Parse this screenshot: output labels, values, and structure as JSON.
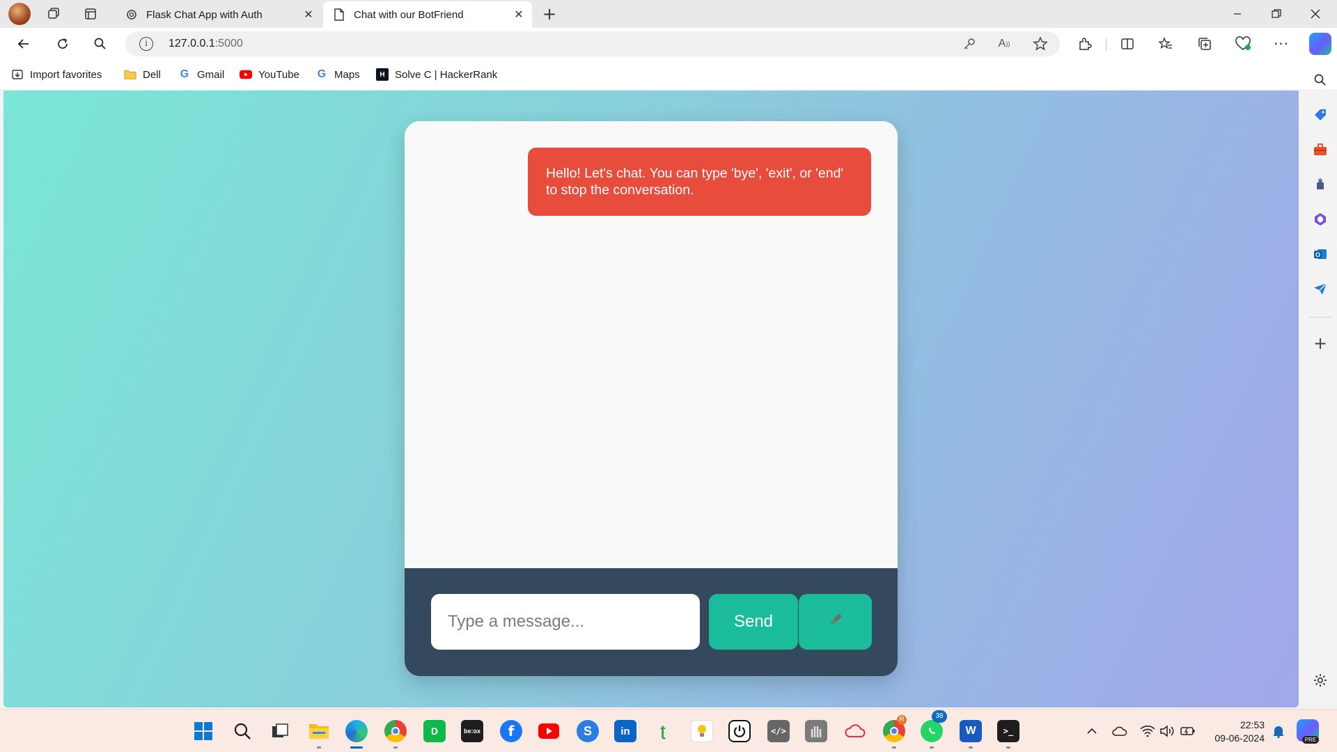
{
  "browser": {
    "tabs": [
      {
        "title": "Flask Chat App with Auth",
        "active": false
      },
      {
        "title": "Chat with our BotFriend",
        "active": true
      }
    ],
    "address": {
      "host": "127.0.0.1",
      "port": ":5000"
    },
    "bookmarks": [
      {
        "label": "Import favorites",
        "icon": "import-icon"
      },
      {
        "label": "Dell",
        "icon": "folder-icon"
      },
      {
        "label": "Gmail",
        "icon": "google-icon"
      },
      {
        "label": "YouTube",
        "icon": "youtube-icon"
      },
      {
        "label": "Maps",
        "icon": "google-icon"
      },
      {
        "label": "Solve C | HackerRank",
        "icon": "hackerrank-icon"
      }
    ]
  },
  "chat": {
    "bot_message": "Hello! Let's chat. You can type 'bye', 'exit', or 'end' to stop the conversation.",
    "input_placeholder": "Type a message...",
    "input_value": "",
    "send_label": "Send",
    "mic_icon": "microphone-icon"
  },
  "colors": {
    "bot_bubble": "#e74c3c",
    "input_bar": "#34495e",
    "button": "#1abc9c",
    "bg_start": "#79e6d6",
    "bg_end": "#a2a7ea"
  },
  "taskbar": {
    "time": "22:53",
    "date": "09-06-2024",
    "whatsapp_badge": "38",
    "chrome_badge": "R",
    "copilot_tag": "PRE"
  }
}
